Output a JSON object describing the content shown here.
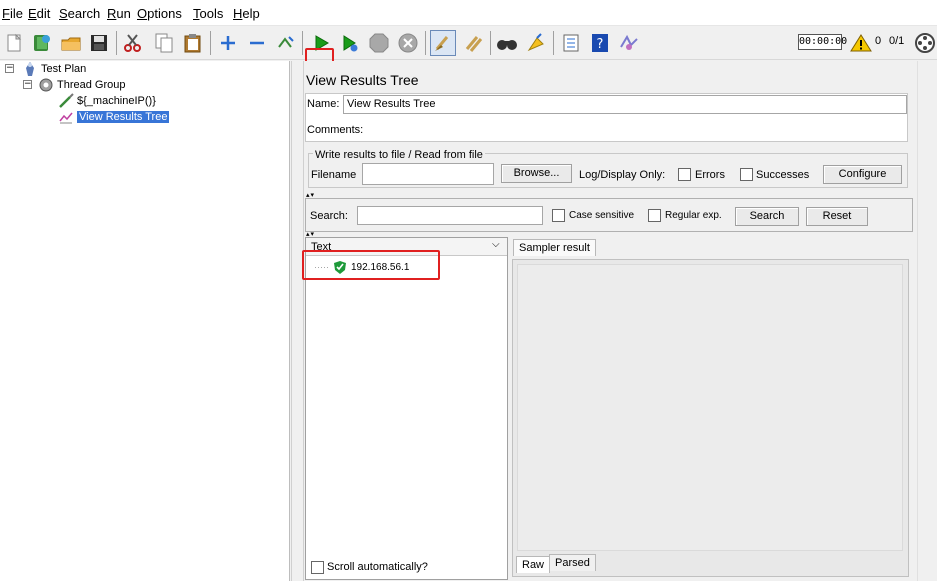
{
  "menu": [
    "File",
    "Edit",
    "Search",
    "Run",
    "Options",
    "Tools",
    "Help"
  ],
  "toolbar": {
    "timer": "00:00:00",
    "warning_count": "0",
    "threads": "0/1",
    "icons": [
      "new-icon",
      "templates-icon",
      "open-icon",
      "save-icon",
      "cut-icon",
      "copy-icon",
      "paste-icon",
      "expand-icon",
      "collapse-icon",
      "toggle-icon",
      "start-icon",
      "start-no-pauses-icon",
      "stop-icon",
      "shutdown-icon",
      "clear-icon",
      "clear-all-icon",
      "search-icon",
      "reset-search-icon",
      "function-helper-icon",
      "help-icon",
      "remote-icon",
      "warning-icon",
      "remote-status-icon"
    ]
  },
  "tree": {
    "items": [
      {
        "label": "Test Plan",
        "icon": "test-plan-icon"
      },
      {
        "label": "Thread Group",
        "icon": "thread-group-icon"
      },
      {
        "label": "${_machineIP()}",
        "icon": "sampler-icon"
      },
      {
        "label": "View Results Tree",
        "icon": "listener-icon",
        "selected": true
      }
    ]
  },
  "panel": {
    "title": "View Results Tree",
    "name_label": "Name:",
    "name_value": "View Results Tree",
    "comments_label": "Comments:",
    "comments_value": "",
    "file_group_title": "Write results to file / Read from file",
    "filename_label": "Filename",
    "filename_value": "",
    "browse_button": "Browse...",
    "log_display_label": "Log/Display Only:",
    "errors_label": "Errors",
    "successes_label": "Successes",
    "configure_button": "Configure",
    "search_label": "Search:",
    "search_value": "",
    "case_sensitive_label": "Case sensitive",
    "regular_exp_label": "Regular exp.",
    "search_button": "Search",
    "reset_button": "Reset",
    "renderer_selected": "Text",
    "results": [
      {
        "label": "192.168.56.1",
        "status": "success"
      }
    ],
    "scroll_auto_label": "Scroll automatically?",
    "sampler_tab": "Sampler result",
    "bottom_tabs": [
      "Raw",
      "Parsed"
    ]
  },
  "colors": {
    "highlight": "#e02020",
    "selection": "#3875d7",
    "run_green": "#1a9c1a"
  }
}
